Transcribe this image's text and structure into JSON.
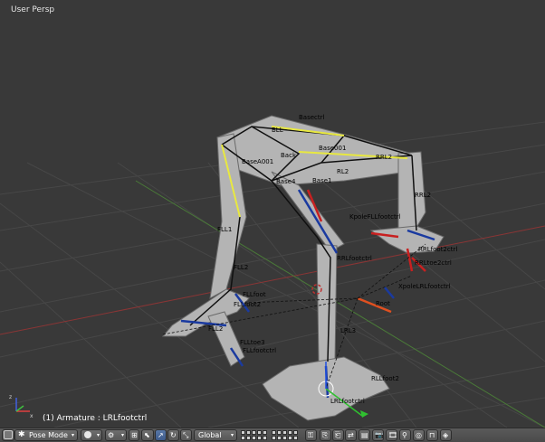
{
  "viewport": {
    "view_label": "User Persp",
    "status_text": "(1) Armature : LRLfootctrl"
  },
  "bone_labels": [
    "Basectrl",
    "Base001",
    "BaseA001",
    "Back",
    "Base4",
    "FLL2",
    "RRL2",
    "RRL2",
    "Root",
    "FLLfoot2",
    "RLLfoot2",
    "FLLfoot",
    "RL2",
    "FLL2",
    "LRLfootctrl",
    "LRL3",
    "RRLfootctrl",
    "XpoleLRLfootctrl",
    "RRLtoe2ctrl",
    "RRLfoot2ctrl",
    "FLLtoe3",
    "FLLfootctrl",
    "KpoleFLLfootctrl",
    "Base1",
    "BLL",
    "FLL1"
  ],
  "header": {
    "mode_label": "Pose Mode",
    "orientation_label": "Global",
    "icons": {
      "editor_type": "view3d-icon",
      "shading": "solid-sphere-icon",
      "pivot": "pivot-icon",
      "manipulator": "manipulator-icon",
      "translate": "translate-arrow-icon",
      "rotate": "rotate-icon",
      "scale": "scale-icon",
      "lock": "lock-icon",
      "pose_copy": "copy-pose-icon",
      "pose_paste": "paste-pose-icon",
      "pose_flip": "flip-pose-icon",
      "render": "render-icon",
      "render_anim": "render-anim-icon"
    }
  },
  "colors": {
    "viewport_bg": "#393939",
    "grid": "#4a4a4a",
    "axis_red": "#a03a3a",
    "axis_green": "#4d8a3a",
    "header_bg": "#4f4f4f",
    "active_button": "#5070a0",
    "bone_yellow": "#e8e840",
    "ik_blue": "#1a3aa0",
    "ik_red": "#c82020",
    "root_orange": "#e05020"
  }
}
